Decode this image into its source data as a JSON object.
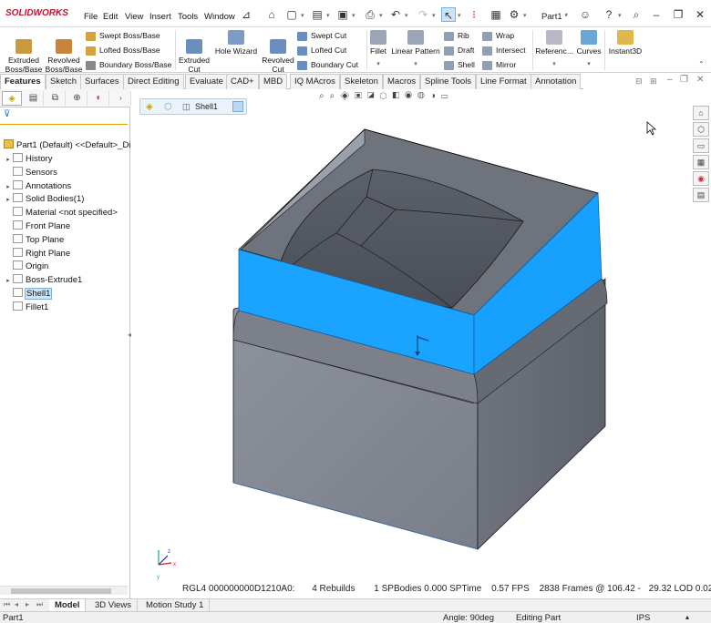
{
  "app": {
    "logo": "SOLIDWORKS",
    "doc_title": "Part1 *"
  },
  "menu": [
    "File",
    "Edit",
    "View",
    "Insert",
    "Tools",
    "Window"
  ],
  "toolbar_icons": [
    "pin-icon",
    "home-icon",
    "new-icon",
    "open-icon",
    "save-icon",
    "print-icon",
    "undo-icon",
    "redo-icon",
    "select-icon",
    "traffic-light-icon",
    "file-properties-icon",
    "options-icon",
    "account-icon",
    "help-icon",
    "search-icon",
    "minimize-icon",
    "restore-icon",
    "close-icon"
  ],
  "commands": {
    "extruded_boss": "Extruded\nBoss/Base",
    "revolved_boss": "Revolved\nBoss/Base",
    "swept_boss": "Swept Boss/Base",
    "lofted_boss": "Lofted Boss/Base",
    "boundary_boss": "Boundary Boss/Base",
    "extruded_cut": "Extruded\nCut",
    "hole_wizard": "Hole Wizard",
    "revolved_cut": "Revolved\nCut",
    "swept_cut": "Swept Cut",
    "lofted_cut": "Lofted Cut",
    "boundary_cut": "Boundary Cut",
    "fillet": "Fillet",
    "linear_pattern": "Linear Pattern",
    "rib": "Rib",
    "draft": "Draft",
    "shell": "Shell",
    "wrap": "Wrap",
    "intersect": "Intersect",
    "mirror": "Mirror",
    "reference": "Referenc...",
    "curves": "Curves",
    "instant3d": "Instant3D"
  },
  "tabs": [
    "Features",
    "Sketch",
    "Surfaces",
    "Direct Editing",
    "Evaluate",
    "CAD+",
    "MBD",
    "IQ MAcros",
    "Skeleton",
    "Macros",
    "Spline Tools",
    "Line Format",
    "Annotation"
  ],
  "breadcrumb": {
    "feature": "Shell1"
  },
  "tree": {
    "root": "Part1 (Default) <<Default>_Di",
    "items": [
      {
        "label": "History",
        "expand": true
      },
      {
        "label": "Sensors",
        "expand": false
      },
      {
        "label": "Annotations",
        "expand": true
      },
      {
        "label": "Solid Bodies(1)",
        "expand": true
      },
      {
        "label": "Material <not specified>",
        "expand": false
      },
      {
        "label": "Front Plane",
        "expand": false
      },
      {
        "label": "Top Plane",
        "expand": false
      },
      {
        "label": "Right Plane",
        "expand": false
      },
      {
        "label": "Origin",
        "expand": false
      },
      {
        "label": "Boss-Extrude1",
        "expand": true
      },
      {
        "label": "Shell1",
        "expand": false,
        "selected": true
      },
      {
        "label": "Fillet1",
        "expand": false
      }
    ]
  },
  "perf": {
    "rgl": "RGL4 000000000D1210A0:",
    "rebuilds": "4 Rebuilds",
    "bodies": "1 SPBodies  0.000 SPTime",
    "fps": "0.57 FPS",
    "frames": "2838 Frames @ 106.42 -",
    "lod": "29.32 LOD 0.02"
  },
  "bottom_tabs": [
    "Model",
    "3D Views",
    "Motion Study 1"
  ],
  "status": {
    "doc": "Part1",
    "angle": "Angle: 90deg",
    "mode": "Editing Part",
    "units": "IPS"
  },
  "colors": {
    "highlight_face": "#1aa3ff",
    "body_gray": "#858a96",
    "accent": "#c8102e"
  }
}
